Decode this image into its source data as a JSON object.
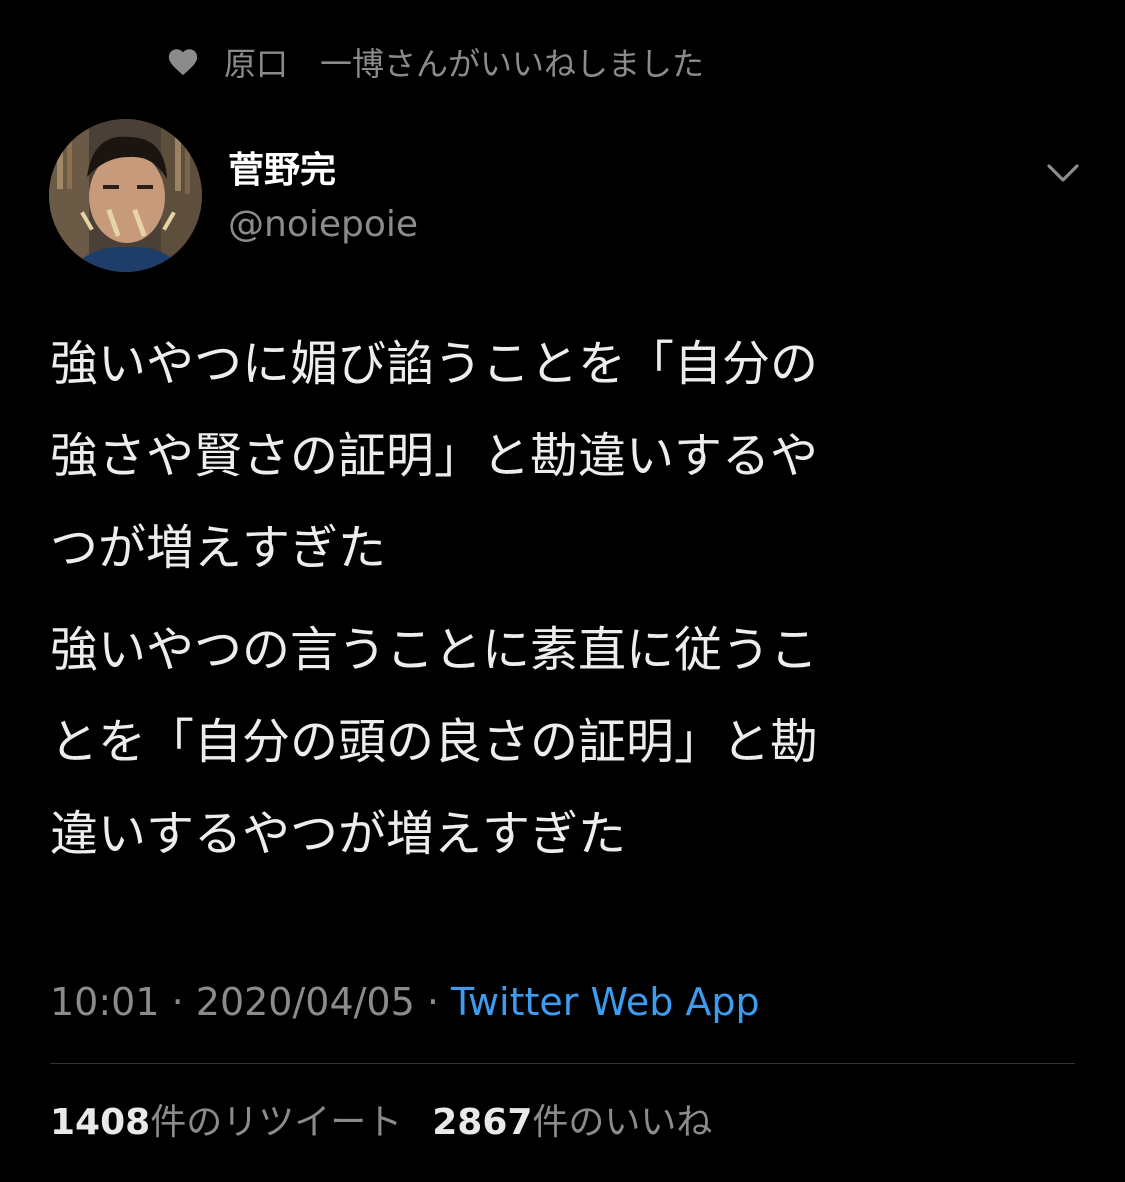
{
  "social_context": {
    "icon": "heart-icon",
    "text": "原口　一博さんがいいねしました"
  },
  "author": {
    "display_name": "菅野完",
    "handle": "@noiepoie"
  },
  "tweet": {
    "paragraphs": [
      "強いやつに媚び諂うことを「自分の\n強さや賢さの証明」と勘違いするや\nつが増えすぎた",
      "強いやつの言うことに素直に従うこ\nとを「自分の頭の良さの証明」と勘\n違いするやつが増えすぎた"
    ]
  },
  "meta": {
    "time": "10:01",
    "separator1": " · ",
    "date": "2020/04/05",
    "separator2": " · ",
    "source": "Twitter Web App"
  },
  "stats": {
    "retweet_count": "1408",
    "retweet_label": "件のリツイート",
    "like_count": "2867",
    "like_label": "件のいいね"
  },
  "colors": {
    "background": "#000000",
    "text": "#e7e9ea",
    "secondary": "#8b8b8b",
    "link": "#3d9bf0",
    "divider": "#2f3336"
  }
}
